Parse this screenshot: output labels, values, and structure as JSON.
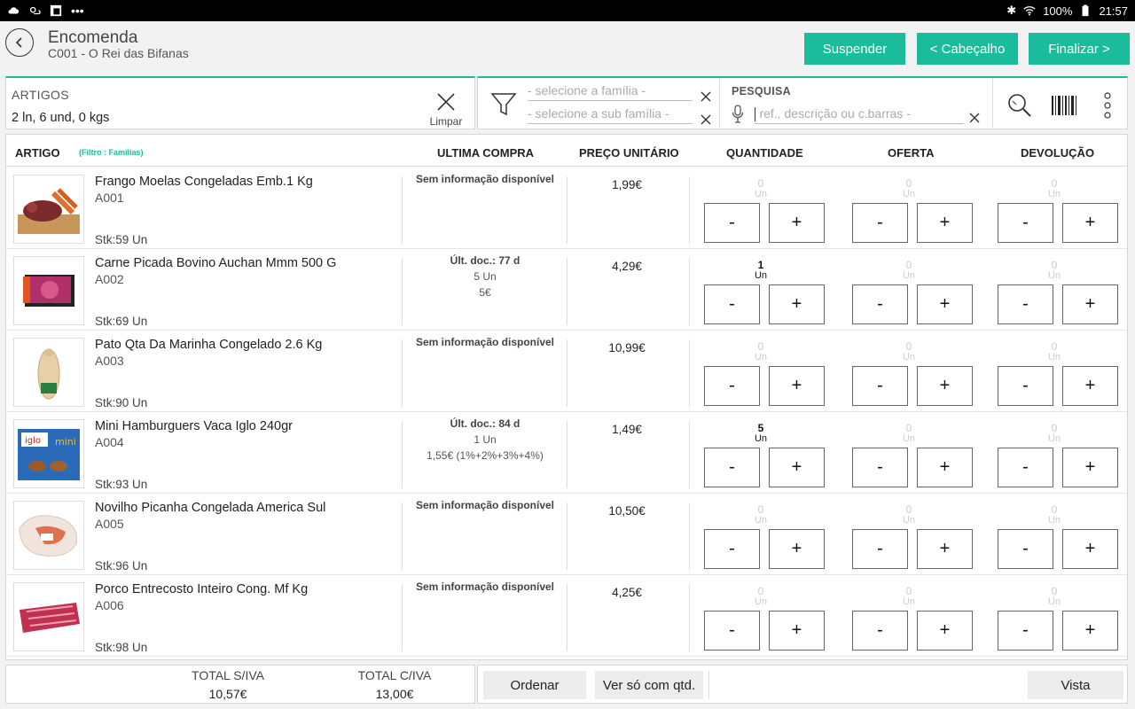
{
  "status": {
    "battery": "100%",
    "time": "21:57"
  },
  "header": {
    "title": "Encomenda",
    "subtitle": "C001 - O Rei das Bifanas",
    "suspend_label": "Suspender",
    "header_label": "< Cabeçalho",
    "finish_label": "Finalizar >"
  },
  "articles_panel": {
    "label": "ARTIGOS",
    "summary": "2 ln, 6 und, 0 kgs",
    "clear_label": "Limpar"
  },
  "filters": {
    "family_placeholder": "- selecione a família -",
    "subfamily_placeholder": "- selecione a sub família -"
  },
  "search": {
    "label": "PESQUISA",
    "placeholder": "ref., descrição ou c.barras -"
  },
  "table": {
    "headers": {
      "artigo": "ARTIGO",
      "filter_note": "(Filtro : Famílias)",
      "ultima": "ULTIMA COMPRA",
      "preco": "PREÇO UNITÁRIO",
      "quantidade": "QUANTIDADE",
      "oferta": "OFERTA",
      "devolucao": "DEVOLUÇÃO"
    },
    "minus_label": "-",
    "plus_label": "+",
    "rows": [
      {
        "name": "Frango Moelas Congeladas Emb.1 Kg",
        "code": "A001",
        "stock": "Stk:59 Un",
        "last_1": "Sem informação disponível",
        "last_2": "",
        "last_3": "",
        "price": "1,99€",
        "qty": "0",
        "qty_unit": "Un",
        "offer": "0",
        "offer_unit": "Un",
        "ret": "0",
        "ret_unit": "Un"
      },
      {
        "name": "Carne Picada Bovino Auchan Mmm 500 G",
        "code": "A002",
        "stock": "Stk:69 Un",
        "last_1": "Últ. doc.: 77 d",
        "last_2": "5 Un",
        "last_3": "5€",
        "price": "4,29€",
        "qty": "1",
        "qty_unit": "Un",
        "offer": "0",
        "offer_unit": "Un",
        "ret": "0",
        "ret_unit": "Un"
      },
      {
        "name": "Pato Qta Da Marinha Congelado 2.6 Kg",
        "code": "A003",
        "stock": "Stk:90 Un",
        "last_1": "Sem informação disponível",
        "last_2": "",
        "last_3": "",
        "price": "10,99€",
        "qty": "0",
        "qty_unit": "Un",
        "offer": "0",
        "offer_unit": "Un",
        "ret": "0",
        "ret_unit": "Un"
      },
      {
        "name": "Mini Hamburguers Vaca Iglo 240gr",
        "code": "A004",
        "stock": "Stk:93 Un",
        "last_1": "Últ. doc.: 84 d",
        "last_2": "1 Un",
        "last_3": "1,55€ (1%+2%+3%+4%)",
        "price": "1,49€",
        "qty": "5",
        "qty_unit": "Un",
        "offer": "0",
        "offer_unit": "Un",
        "ret": "0",
        "ret_unit": "Un"
      },
      {
        "name": "Novilho Picanha Congelada America Sul",
        "code": "A005",
        "stock": "Stk:96 Un",
        "last_1": "Sem informação disponível",
        "last_2": "",
        "last_3": "",
        "price": "10,50€",
        "qty": "0",
        "qty_unit": "Un",
        "offer": "0",
        "offer_unit": "Un",
        "ret": "0",
        "ret_unit": "Un"
      },
      {
        "name": "Porco Entrecosto Inteiro Cong. Mf Kg",
        "code": "A006",
        "stock": "Stk:98 Un",
        "last_1": "Sem informação disponível",
        "last_2": "",
        "last_3": "",
        "price": "4,25€",
        "qty": "0",
        "qty_unit": "Un",
        "offer": "0",
        "offer_unit": "Un",
        "ret": "0",
        "ret_unit": "Un"
      }
    ]
  },
  "footer": {
    "total_siva_label": "TOTAL S/IVA",
    "total_siva": "10,57€",
    "total_civa_label": "TOTAL C/IVA",
    "total_civa": "13,00€",
    "order_label": "Ordenar",
    "only_qty_label": "Ver só com qtd.",
    "view_label": "Vista"
  },
  "colors": {
    "accent": "#1bbc9b"
  }
}
